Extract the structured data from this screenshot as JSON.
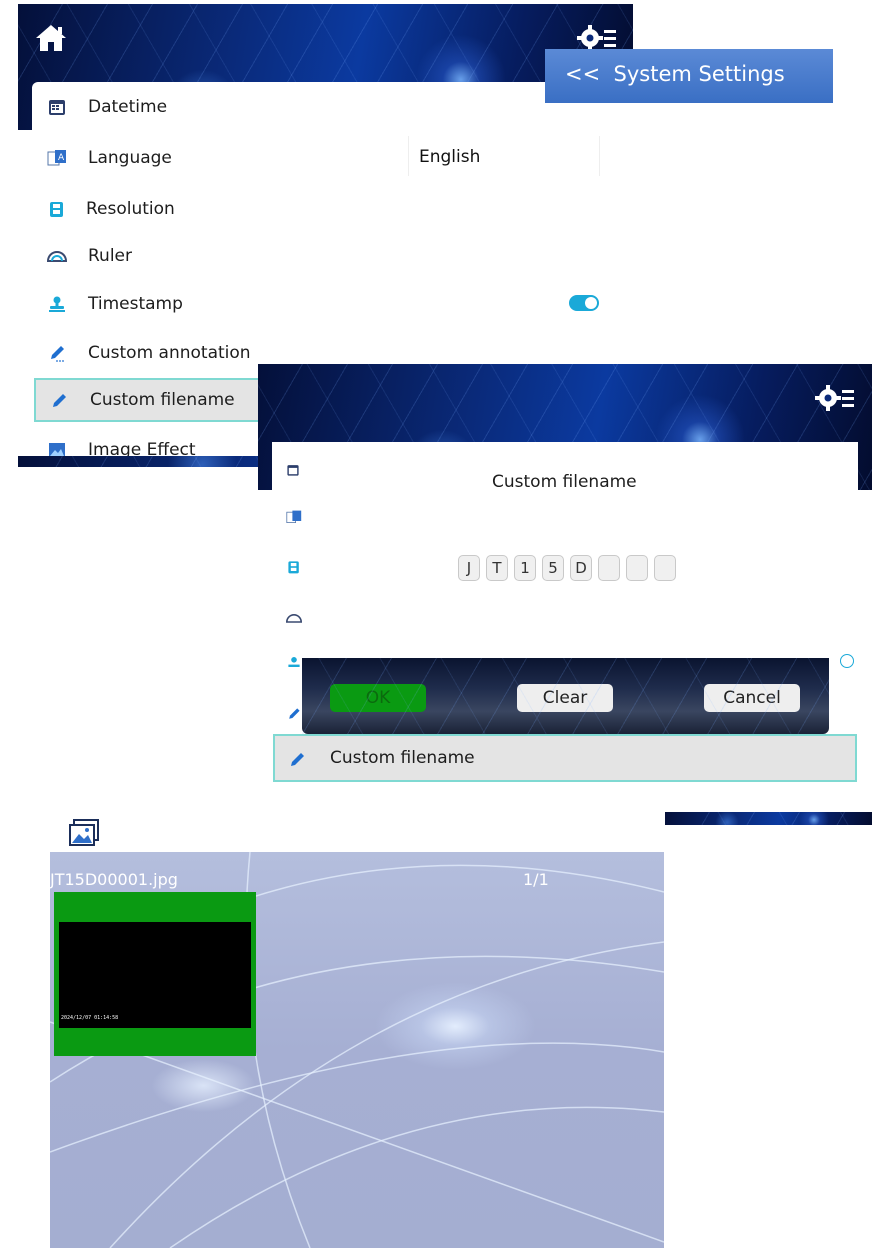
{
  "panel1": {
    "breadcrumb": "<<  System Settings",
    "menu": [
      {
        "label": "Datetime",
        "icon": "calendar-icon"
      },
      {
        "label": "Language",
        "icon": "language-icon",
        "value": "English"
      },
      {
        "label": "Resolution",
        "icon": "film-icon"
      },
      {
        "label": "Ruler",
        "icon": "protractor-icon"
      },
      {
        "label": "Timestamp",
        "icon": "stamp-icon"
      },
      {
        "label": "Custom annotation",
        "icon": "pencil-icon"
      },
      {
        "label": "Custom filename",
        "icon": "pencil-icon"
      },
      {
        "label": "Image Effect",
        "icon": "image-icon"
      }
    ],
    "timestamp_enabled": true,
    "accent_color": "#1aa9d8",
    "selected_border_color": "#7fd9d2"
  },
  "panel2": {
    "dialog_title": "Custom filename",
    "chars": [
      "J",
      "T",
      "1",
      "5",
      "D",
      "",
      "",
      ""
    ],
    "ok_label": "OK",
    "clear_label": "Clear",
    "cancel_label": "Cancel",
    "selected_item_label": "Custom filename",
    "ok_color": "#0a9a12"
  },
  "panel3": {
    "filename": "JT15D00001.jpg",
    "page": "1/1",
    "thumbnail_timestamp": "2024/12/07 01:14:58",
    "thumbnail_border_color": "#0a9a12"
  }
}
